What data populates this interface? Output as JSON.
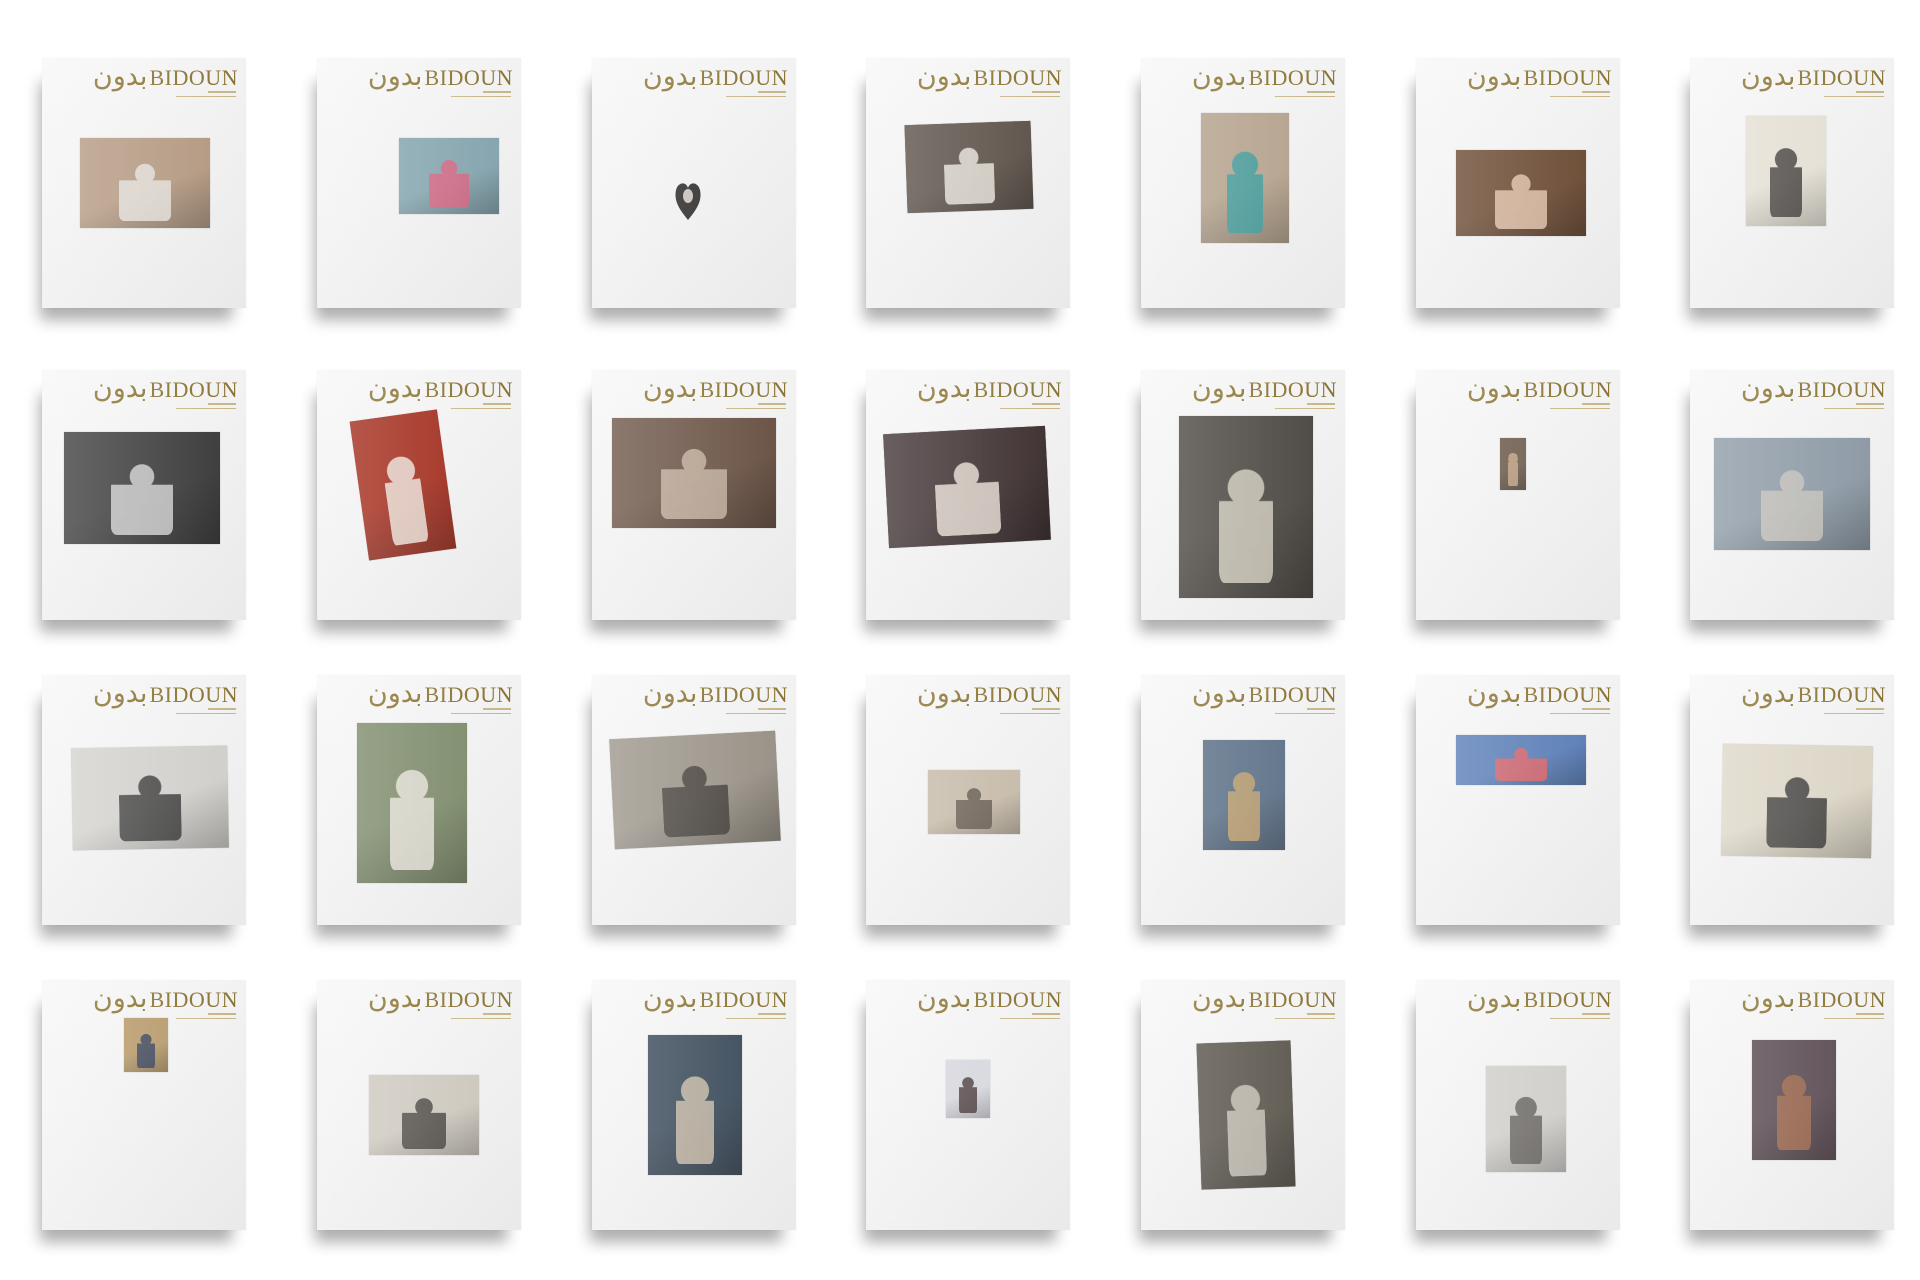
{
  "masthead": {
    "arabic": "بدون",
    "latin": "BIDOUN"
  },
  "covers": [
    {
      "id": "c1",
      "photo": "office-workers-computers",
      "bg": "#b59a82",
      "accent": "#e8e6e2"
    },
    {
      "id": "c2",
      "photo": "bedroom-pink-blanket",
      "bg": "#86a6b0",
      "accent": "#e0607f"
    },
    {
      "id": "c3",
      "photo": "heart-shaped-portrait",
      "bg": "#2c2a28",
      "accent": "#c8c2ba"
    },
    {
      "id": "c4",
      "photo": "rifle-display",
      "bg": "#5b5048",
      "accent": "#f1ece2"
    },
    {
      "id": "c5",
      "photo": "woman-posing-studio",
      "bg": "#b5a28c",
      "accent": "#2f9a9e"
    },
    {
      "id": "c6",
      "photo": "girl-profile-portrait",
      "bg": "#6b4a32",
      "accent": "#e9c9b0"
    },
    {
      "id": "c7",
      "photo": "veiled-woman-portrait",
      "bg": "#e6e1d5",
      "accent": "#2e2a28"
    },
    {
      "id": "c8",
      "photo": "meeting-room-bw",
      "bg": "#3a3a3a",
      "accent": "#d8d8d8"
    },
    {
      "id": "c9",
      "photo": "wedding-couple",
      "bg": "#a22a1a",
      "accent": "#f1ede4"
    },
    {
      "id": "c10",
      "photo": "parliament-session",
      "bg": "#6a5244",
      "accent": "#c9b6a4"
    },
    {
      "id": "c11",
      "photo": "couple-selfie",
      "bg": "#3d2f30",
      "accent": "#f0e6dc"
    },
    {
      "id": "c12",
      "photo": "newspaper-motion-photo",
      "bg": "#4a4640",
      "accent": "#d8d2c2"
    },
    {
      "id": "c13",
      "photo": "small-man-portrait",
      "bg": "#6b5a4a",
      "accent": "#c8a888"
    },
    {
      "id": "c14",
      "photo": "street-with-car",
      "bg": "#8d9aa6",
      "accent": "#c8c4bc"
    },
    {
      "id": "c15",
      "photo": "hospital-visit-bw",
      "bg": "#d4d2ce",
      "accent": "#2a2a2a"
    },
    {
      "id": "c16",
      "photo": "girl-painted-backdrop",
      "bg": "#7d8b6a",
      "accent": "#ece8e0"
    },
    {
      "id": "c17",
      "photo": "girl-reading-book",
      "bg": "#9a9388",
      "accent": "#3a3530"
    },
    {
      "id": "c18",
      "photo": "figure-on-beige",
      "bg": "#c8bcaa",
      "accent": "#5a5046"
    },
    {
      "id": "c19",
      "photo": "child-at-beach",
      "bg": "#5a6f86",
      "accent": "#c9a46a"
    },
    {
      "id": "c20",
      "photo": "group-with-flowers",
      "bg": "#5a7eb8",
      "accent": "#e86060"
    },
    {
      "id": "c21",
      "photo": "skier-newspaper",
      "bg": "#ded8c8",
      "accent": "#2a2a2a"
    },
    {
      "id": "c22",
      "photo": "woman-headscarf-small",
      "bg": "#b89a6a",
      "accent": "#2a3a5a"
    },
    {
      "id": "c23",
      "photo": "reclining-figure-beach",
      "bg": "#cfcac0",
      "accent": "#3a3632"
    },
    {
      "id": "c24",
      "photo": "man-striped-shirt",
      "bg": "#3a4a5a",
      "accent": "#d2c2ac"
    },
    {
      "id": "c25",
      "photo": "id-photo-man",
      "bg": "#d8d8e0",
      "accent": "#3a2a2a"
    },
    {
      "id": "c26",
      "photo": "garden-scene-bw",
      "bg": "#5a554c",
      "accent": "#d0cabe"
    },
    {
      "id": "c27",
      "photo": "man-face-bw",
      "bg": "#d2d0cc",
      "accent": "#5a5652"
    },
    {
      "id": "c28",
      "photo": "man-painted-backdrop",
      "bg": "#5a4a52",
      "accent": "#a46a4a"
    }
  ]
}
